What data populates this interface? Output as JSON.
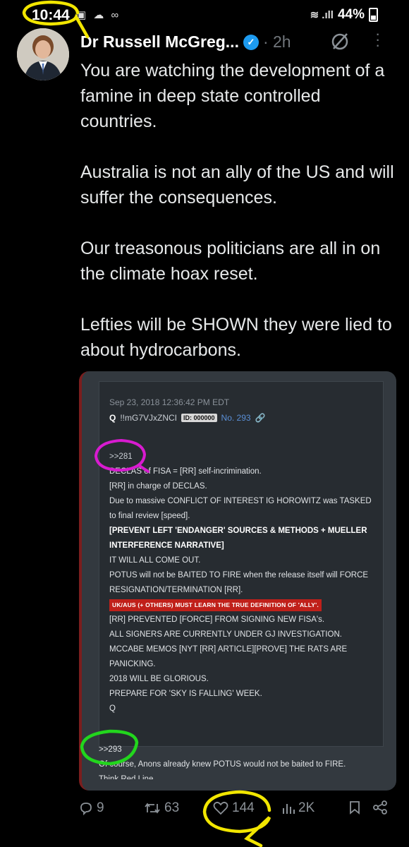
{
  "status_bar": {
    "time": "10:44",
    "battery": "44%"
  },
  "tweet": {
    "author_name": "Dr Russell McGreg...",
    "timestamp": "· 2h",
    "text_paragraphs": [
      "You are watching the development of a famine in deep state controlled countries.",
      "Australia is not an ally of the US and will suffer the consequences.",
      "Our treasonous politicians are all in on the climate hoax reset.",
      "Lefties will be SHOWN they were lied to about hydrocarbons."
    ]
  },
  "q_post": {
    "date": "Sep 23, 2018 12:36:42 PM EDT",
    "name": "Q",
    "tripcode": "!!mG7VJxZNCI",
    "id_badge": "ID: 000000",
    "post_no": "No. 293",
    "ref": ">>281",
    "line1_rest": "of FISA = [RR] self-incrimination.",
    "line1_prefix": "DECLAS",
    "line2": "[RR] in charge of DECLAS.",
    "line3": "Due to massive CONFLICT OF INTEREST IG HOROWITZ was TASKED to final review [speed].",
    "line4": "[PREVENT LEFT 'ENDANGER' SOURCES & METHODS + MUELLER INTERFERENCE NARRATIVE]",
    "line5": "IT WILL ALL COME OUT.",
    "line6": "POTUS will not be BAITED TO FIRE when the release itself will FORCE RESIGNATION/TERMINATION [RR].",
    "highlight": "UK/AUS (+ OTHERS) MUST LEARN THE TRUE DEFINITION OF 'ALLY'.",
    "line7": "[RR] PREVENTED [FORCE] FROM SIGNING NEW FISA's.",
    "line8": "ALL SIGNERS ARE CURRENTLY UNDER GJ INVESTIGATION.",
    "line9": "MCCABE MEMOS [NYT [RR] ARTICLE][PROVE] THE RATS ARE PANICKING.",
    "line10": "2018 WILL BE GLORIOUS.",
    "line11": "PREPARE FOR 'SKY IS FALLING' WEEK.",
    "signature": "Q"
  },
  "reply_post": {
    "ref": ">>293",
    "text": "Of course, Anons already knew POTUS would not be baited to FIRE.",
    "cut_text": "Think Red Line."
  },
  "actions": {
    "replies": "9",
    "reposts": "63",
    "likes": "144",
    "views": "2K"
  },
  "colors": {
    "verified": "#1d9bf0",
    "highlight_bg": "#c0201a",
    "annotation_yellow": "#f2e600",
    "annotation_magenta": "#d81bd0",
    "annotation_green": "#22d61d"
  }
}
